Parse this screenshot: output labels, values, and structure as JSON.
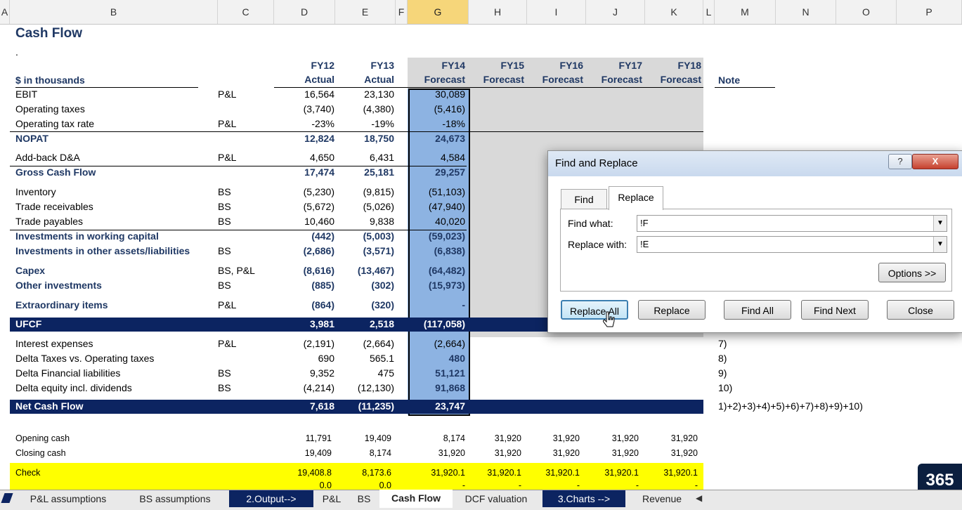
{
  "columns": [
    "A",
    "B",
    "C",
    "D",
    "E",
    "F",
    "G",
    "H",
    "I",
    "J",
    "K",
    "L",
    "M",
    "N",
    "O",
    "P"
  ],
  "title": "Cash Flow",
  "dot": ".",
  "units_label": "$ in thousands",
  "headers": {
    "years": [
      "FY12",
      "FY13",
      "FY14",
      "FY15",
      "FY16",
      "FY17",
      "FY18"
    ],
    "types": [
      "Actual",
      "Actual",
      "Forecast",
      "Forecast",
      "Forecast",
      "Forecast",
      "Forecast"
    ],
    "note": "Note"
  },
  "rows": [
    {
      "label": "EBIT",
      "src": "P&L",
      "d": "16,564",
      "e": "23,130",
      "g": "30,089"
    },
    {
      "label": "Operating taxes",
      "src": "",
      "d": "(3,740)",
      "e": "(4,380)",
      "g": "(5,416)"
    },
    {
      "label": "Operating tax rate",
      "src": "P&L",
      "d": "-23%",
      "e": "-19%",
      "g": "-18%"
    },
    {
      "label": "NOPAT",
      "src": "",
      "d": "12,824",
      "e": "18,750",
      "g": "24,673"
    },
    {
      "label": "Add-back D&A",
      "src": "P&L",
      "d": "4,650",
      "e": "6,431",
      "g": "4,584"
    },
    {
      "label": "Gross Cash Flow",
      "src": "",
      "d": "17,474",
      "e": "25,181",
      "g": "29,257"
    },
    {
      "label": "Inventory",
      "src": "BS",
      "d": "(5,230)",
      "e": "(9,815)",
      "g": "(51,103)"
    },
    {
      "label": "Trade receivables",
      "src": "BS",
      "d": "(5,672)",
      "e": "(5,026)",
      "g": "(47,940)"
    },
    {
      "label": "Trade payables",
      "src": "BS",
      "d": "10,460",
      "e": "9,838",
      "g": "40,020"
    },
    {
      "label": "Investments in working capital",
      "src": "",
      "d": "(442)",
      "e": "(5,003)",
      "g": "(59,023)"
    },
    {
      "label": "Investments in other assets/liabilities",
      "src": "BS",
      "d": "(2,686)",
      "e": "(3,571)",
      "g": "(6,838)"
    },
    {
      "label": "Capex",
      "src": "BS, P&L",
      "d": "(8,616)",
      "e": "(13,467)",
      "g": "(64,482)"
    },
    {
      "label": "Other investments",
      "src": "BS",
      "d": "(885)",
      "e": "(302)",
      "g": "(15,973)"
    },
    {
      "label": "Extraordinary items",
      "src": "P&L",
      "d": "(864)",
      "e": "(320)",
      "g": "-"
    },
    {
      "label": "UFCF",
      "src": "",
      "d": "3,981",
      "e": "2,518",
      "g": "(117,058)"
    },
    {
      "label": "Interest expenses",
      "src": "P&L",
      "d": "(2,191)",
      "e": "(2,664)",
      "g": "(2,664)",
      "note": "7)"
    },
    {
      "label": "Delta Taxes vs. Operating taxes",
      "src": "",
      "d": "690",
      "e": "565.1",
      "g": "480",
      "note": "8)"
    },
    {
      "label": "Delta Financial liabilities",
      "src": "BS",
      "d": "9,352",
      "e": "475",
      "g": "51,121",
      "note": "9)"
    },
    {
      "label": "Delta equity incl. dividends",
      "src": "BS",
      "d": "(4,214)",
      "e": "(12,130)",
      "g": "91,868",
      "note": "10)"
    },
    {
      "label": "Net Cash Flow",
      "src": "",
      "d": "7,618",
      "e": "(11,235)",
      "g": "23,747",
      "note": "1)+2)+3)+4)+5)+6)+7)+8)+9)+10)"
    }
  ],
  "bottom": [
    {
      "label": "Opening cash",
      "vals": [
        "11,791",
        "19,409",
        "8,174",
        "31,920",
        "31,920",
        "31,920",
        "31,920"
      ]
    },
    {
      "label": "Closing cash",
      "vals": [
        "19,409",
        "8,174",
        "31,920",
        "31,920",
        "31,920",
        "31,920",
        "31,920"
      ]
    },
    {
      "label": "Check",
      "vals": [
        "19,408.8",
        "8,173.6",
        "31,920.1",
        "31,920.1",
        "31,920.1",
        "31,920.1",
        "31,920.1"
      ],
      "vals2": [
        "0.0",
        "0.0",
        "-",
        "-",
        "-",
        "-",
        "-"
      ]
    }
  ],
  "dialog": {
    "title": "Find and Replace",
    "tab_find": "Find",
    "tab_replace": "Replace",
    "find_label": "Find what:",
    "find_value": "!F",
    "replace_label": "Replace with:",
    "replace_value": "!E",
    "options": "Options >>",
    "replace_all": "Replace All",
    "replace": "Replace",
    "find_all": "Find All",
    "find_next": "Find Next",
    "close": "Close",
    "help": "?",
    "close_x": "X"
  },
  "sheet_tabs": [
    "P&L assumptions",
    "BS assumptions",
    "2.Output-->",
    "P&L",
    "BS",
    "Cash Flow",
    "DCF valuation",
    "3.Charts  -->",
    "Revenue"
  ],
  "active_tab": "Cash Flow",
  "logo": "365"
}
